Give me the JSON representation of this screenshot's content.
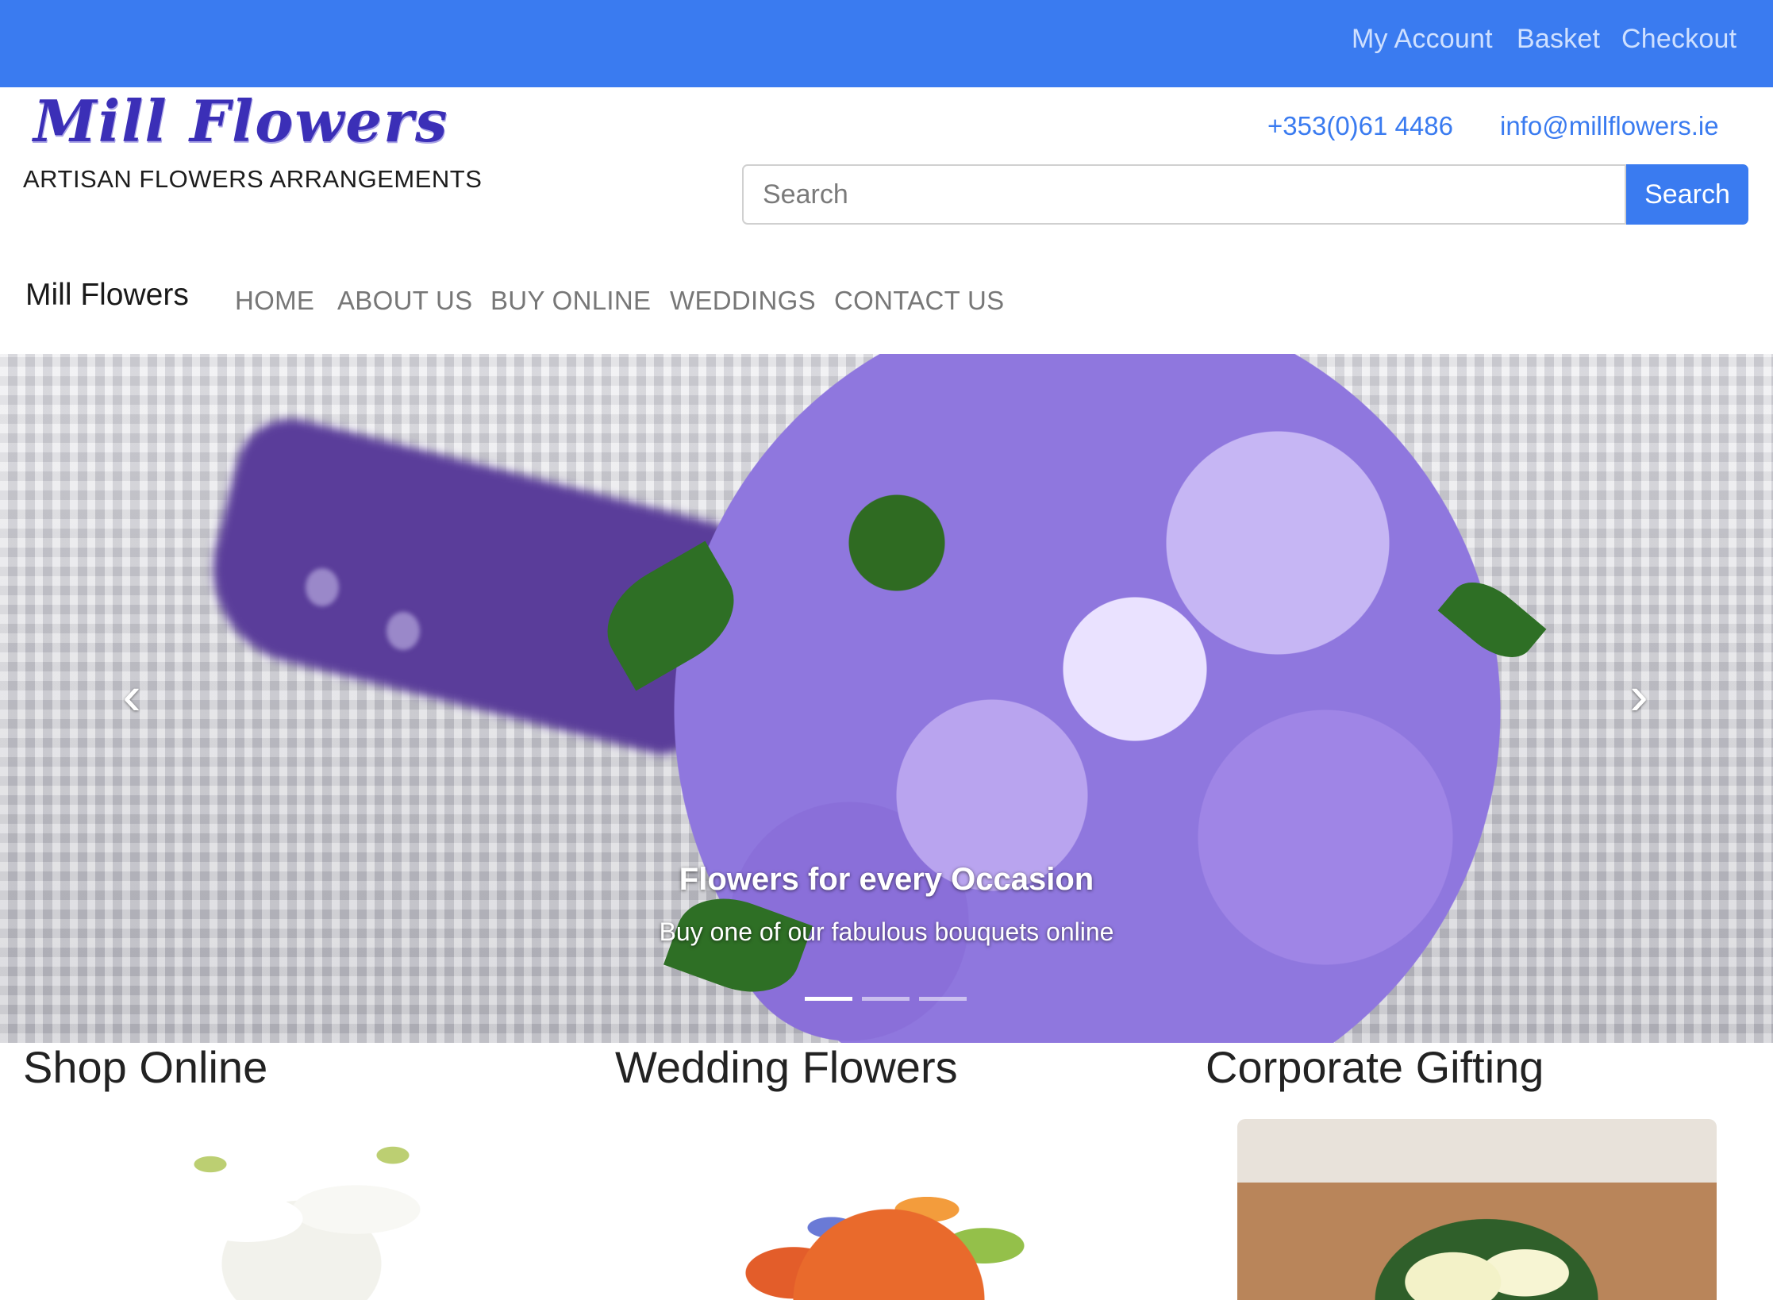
{
  "topbar": {
    "my_account": "My Account",
    "basket": "Basket",
    "checkout": "Checkout",
    "color": "#3a7bf0"
  },
  "header": {
    "logo": "Mill Flowers",
    "tagline": "ARTISAN FLOWERS ARRANGEMENTS",
    "phone": "+353(0)61 4486",
    "email": "info@millflowers.ie"
  },
  "search": {
    "placeholder": "Search",
    "button_label": "Search"
  },
  "nav": {
    "brand": "Mill Flowers",
    "items": [
      {
        "label": "HOME"
      },
      {
        "label": "ABOUT US"
      },
      {
        "label": "BUY ONLINE"
      },
      {
        "label": "WEDDINGS"
      },
      {
        "label": "CONTACT US"
      }
    ]
  },
  "carousel": {
    "caption_title": "Flowers for every Occasion",
    "caption_text": "Buy one of our fabulous bouquets online",
    "active_index": 0,
    "slide_count": 3,
    "prev_icon": "chevron-left-icon",
    "next_icon": "chevron-right-icon",
    "prev_glyph": "‹",
    "next_glyph": "›"
  },
  "sections": [
    {
      "title": "Shop Online"
    },
    {
      "title": "Wedding Flowers"
    },
    {
      "title": "Corporate Gifting"
    }
  ]
}
